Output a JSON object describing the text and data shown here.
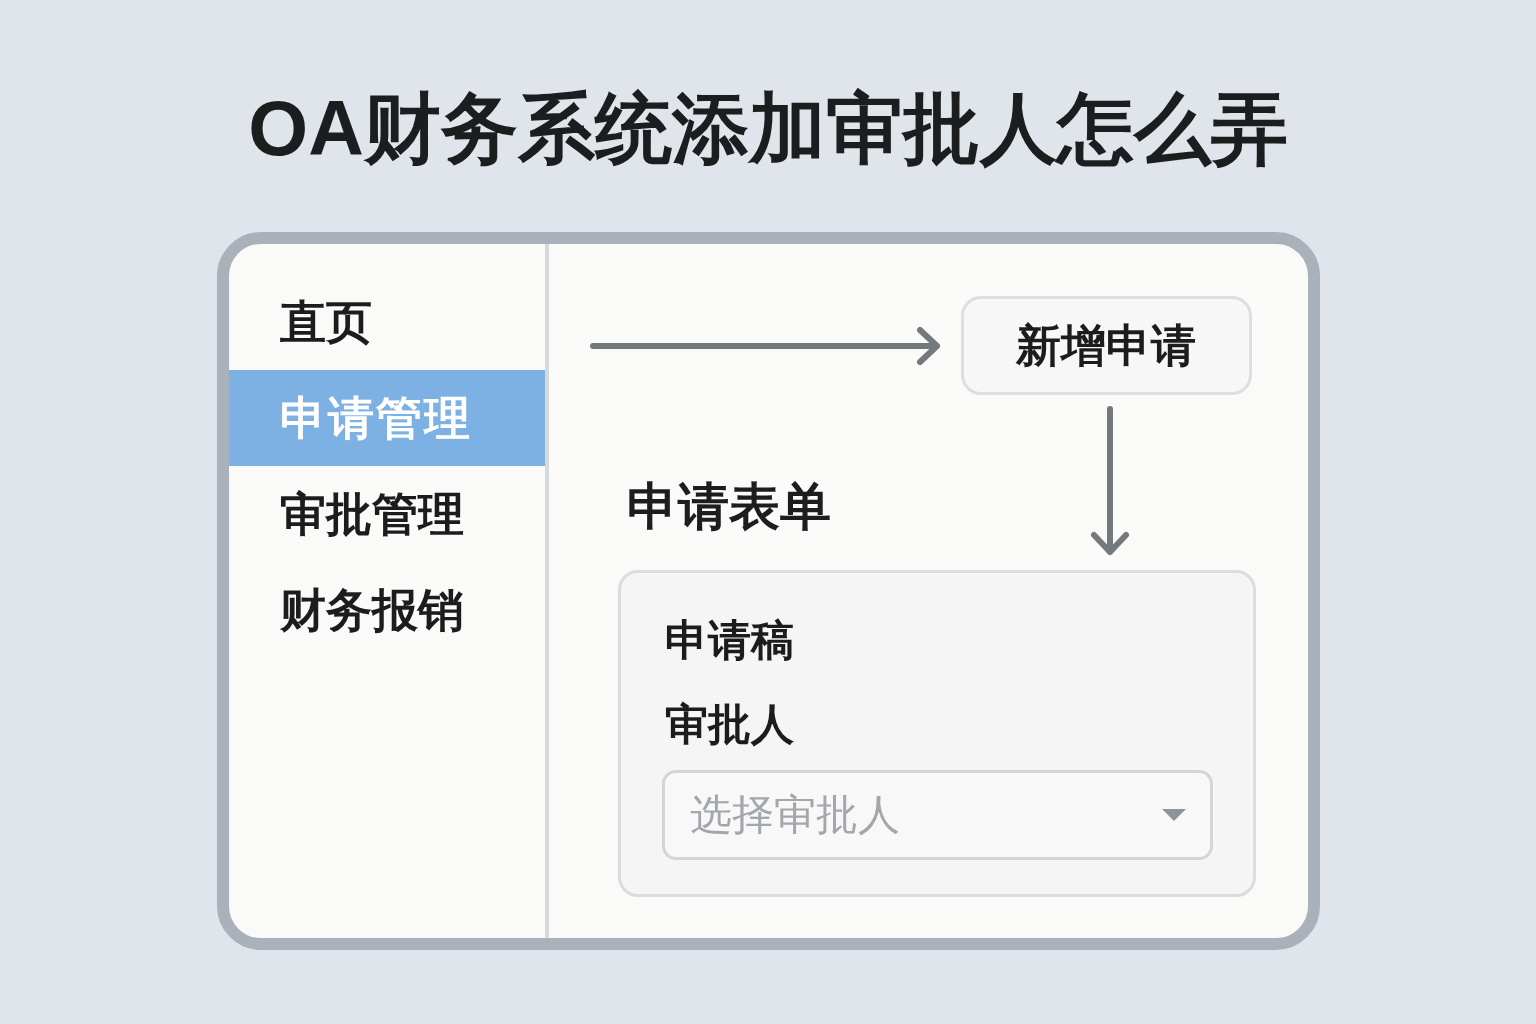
{
  "title": "OA财务系统添加审批人怎么弄",
  "sidebar": {
    "items": [
      {
        "label": "直页",
        "selected": false
      },
      {
        "label": "申请管理",
        "selected": true
      },
      {
        "label": "审批管理",
        "selected": false
      },
      {
        "label": "财务报销",
        "selected": false
      }
    ]
  },
  "main": {
    "new_request_button": {
      "label": "新增申请"
    },
    "form": {
      "title": "申请表单",
      "draft_label": "申请稿",
      "approver": {
        "label": "审批人",
        "placeholder": "选择审批人"
      }
    }
  }
}
